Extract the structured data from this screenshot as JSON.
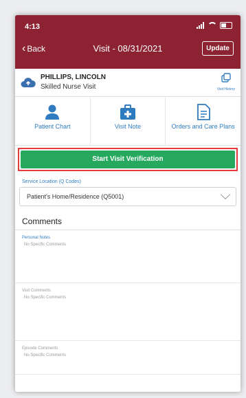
{
  "status_bar": {
    "time": "4:13"
  },
  "nav": {
    "back_label": "Back",
    "title": "Visit - 08/31/2021",
    "update_label": "Update"
  },
  "patient": {
    "name": "PHILLIPS, LINCOLN",
    "visit_type": "Skilled Nurse Visit",
    "history_label": "Visit History"
  },
  "tiles": [
    {
      "label": "Patient Chart",
      "icon": "person-icon"
    },
    {
      "label": "Visit Note",
      "icon": "medical-kit-icon"
    },
    {
      "label": "Orders and Care Plans",
      "icon": "document-icon"
    }
  ],
  "verify_button": {
    "label": "Start Visit Verification"
  },
  "service_location": {
    "label": "Service Location (Q Codes)",
    "value": "Patient's Home/Residence (Q5001)"
  },
  "comments": {
    "heading": "Comments",
    "sections": [
      {
        "label": "Personal Notes",
        "text": "No Specific Comments"
      },
      {
        "label": "Visit Comments",
        "text": "No Specific Comments"
      },
      {
        "label": "Episode Comments",
        "text": "No Specific Comments"
      }
    ]
  },
  "colors": {
    "header": "#8c2232",
    "accent": "#2f7bc0",
    "verify": "#26a95f",
    "highlight": "#e23b3b"
  }
}
